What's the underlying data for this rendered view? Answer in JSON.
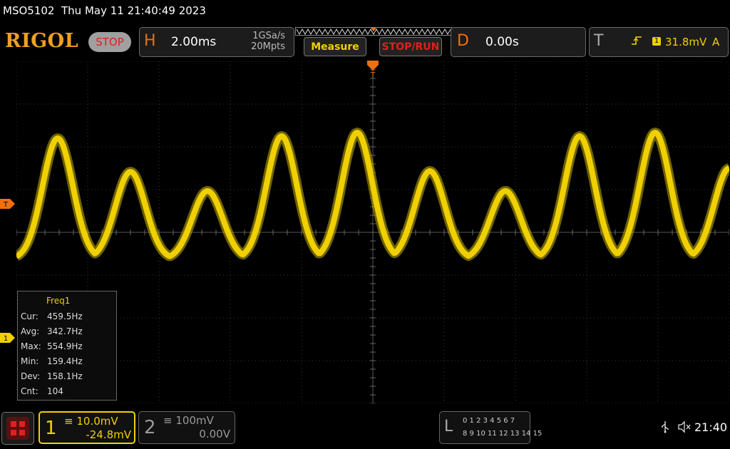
{
  "header": {
    "model": "MSO5102",
    "datetime": "Thu May 11 21:40:49 2023",
    "logo": "RIGOL",
    "run_state": "STOP"
  },
  "horizontal": {
    "letter": "H",
    "timebase": "2.00ms",
    "sample_rate": "1GSa/s",
    "memory_depth": "20Mpts"
  },
  "buttons": {
    "measure": "Measure",
    "stop_run": "STOP/RUN"
  },
  "delay": {
    "letter": "D",
    "value": "0.00s"
  },
  "trigger": {
    "letter": "T",
    "source": "1",
    "level": "31.8mV",
    "mode": "A"
  },
  "markers": {
    "trigger_level": "T",
    "channel1": "1"
  },
  "measurement": {
    "title": "Freq1",
    "rows": [
      {
        "label": "Cur:",
        "value": "459.5Hz"
      },
      {
        "label": "Avg:",
        "value": "342.7Hz"
      },
      {
        "label": "Max:",
        "value": "554.9Hz"
      },
      {
        "label": "Min:",
        "value": "159.4Hz"
      },
      {
        "label": "Dev:",
        "value": "158.1Hz"
      },
      {
        "label": "Cnt:",
        "value": "104"
      }
    ]
  },
  "channels": [
    {
      "number": "1",
      "scale": "10.0mV",
      "offset": "-24.8mV"
    },
    {
      "number": "2",
      "scale": "100mV",
      "offset": "0.00V"
    }
  ],
  "logic_analyzer": {
    "letter": "L",
    "row1": "0 1 2 3   4 5 6 7",
    "row2": "8 9 10 11 12 13 14 15"
  },
  "status": {
    "clock": "21:40"
  },
  "colors": {
    "channel1": "#f0d000",
    "accent_orange": "#f07010",
    "stop_red": "#e0201a",
    "grid": "#3a3a3a"
  }
}
